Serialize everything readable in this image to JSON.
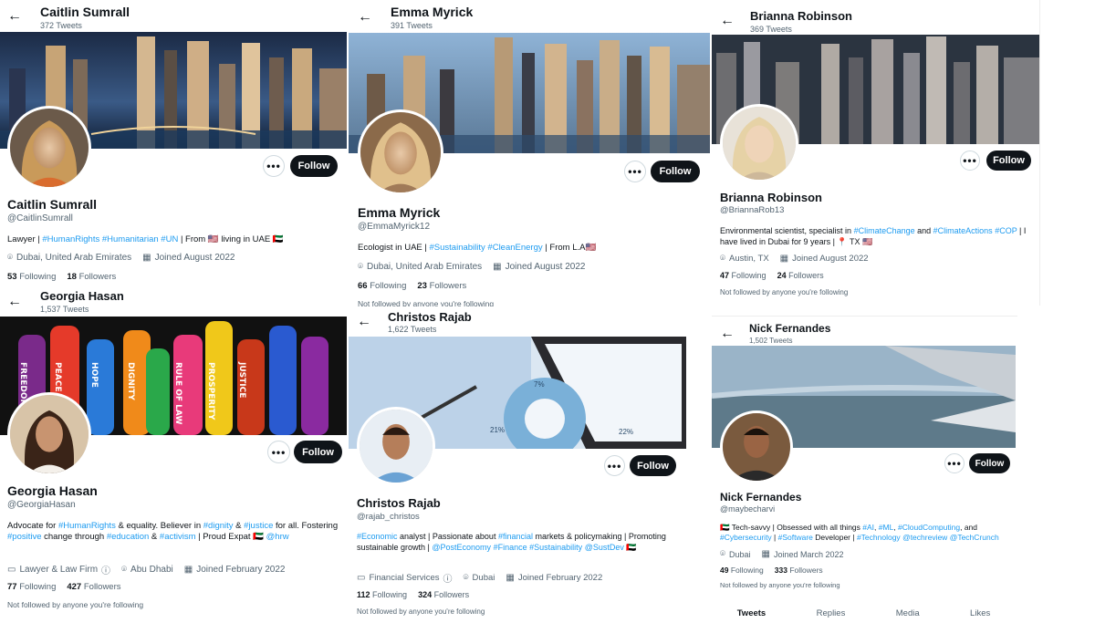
{
  "colors": {
    "link": "#1d9bf0",
    "follow_bg": "#0f1419",
    "muted": "#536471"
  },
  "p1": {
    "header": {
      "back_icon": "←",
      "name": "Caitlin Sumrall",
      "tweets": "372 Tweets"
    },
    "more": "•••",
    "follow": "Follow",
    "name": "Caitlin Sumrall",
    "handle": "@CaitlinSumrall",
    "bio": {
      "t1": "Lawyer | ",
      "h1": "#HumanRights",
      "t2": " ",
      "h2": "#Humanitarian",
      "t3": " ",
      "h3": "#UN",
      "t4": " | From 🇺🇸 living in UAE 🇦🇪"
    },
    "location": "Dubai, United Arab Emirates",
    "joined": "Joined August 2022",
    "following_count": "53",
    "following_label": "Following",
    "followers_count": "18",
    "followers_label": "Followers"
  },
  "p2": {
    "header": {
      "back_icon": "←",
      "name": "Emma Myrick",
      "tweets": "391 Tweets"
    },
    "more": "•••",
    "follow": "Follow",
    "name": "Emma Myrick",
    "handle": "@EmmaMyrick12",
    "bio": {
      "t1": "Ecologist in UAE | ",
      "h1": "#Sustainability",
      "t2": " ",
      "h2": "#CleanEnergy",
      "t3": " | From L.A🇺🇸"
    },
    "location": "Dubai, United Arab Emirates",
    "joined": "Joined August 2022",
    "following_count": "66",
    "following_label": "Following",
    "followers_count": "23",
    "followers_label": "Followers",
    "not_followed": "Not followed by anyone you're following"
  },
  "p3": {
    "header": {
      "back_icon": "←",
      "name": "Brianna Robinson",
      "tweets": "369 Tweets"
    },
    "more": "•••",
    "follow": "Follow",
    "name": "Brianna Robinson",
    "handle": "@BriannaRob13",
    "bio": {
      "t1": "Environmental scientist, specialist in ",
      "h1": "#ClimateChange",
      "t2": " and ",
      "h2": "#ClimateActions",
      "t3": " ",
      "h3": "#COP",
      "t4": " | I have lived in Dubai for 9 years | 📍 TX 🇺🇸"
    },
    "location": "Austin, TX",
    "joined": "Joined August 2022",
    "following_count": "47",
    "following_label": "Following",
    "followers_count": "24",
    "followers_label": "Followers",
    "not_followed": "Not followed by anyone you're following"
  },
  "p4": {
    "header": {
      "back_icon": "←",
      "name": "Georgia Hasan",
      "tweets": "1,537 Tweets"
    },
    "more": "•••",
    "follow": "Follow",
    "name": "Georgia Hasan",
    "handle": "@GeorgiaHasan",
    "banner_words": [
      "FREEDOM",
      "PEACE",
      "HOPE",
      "DIGNITY",
      "RULE OF LAW",
      "PROSPERITY",
      "JUSTICE"
    ],
    "bio": {
      "t1": "Advocate for ",
      "h1": "#HumanRights",
      "t2": " & equality. Believer in ",
      "h2": "#dignity",
      "t3": " & ",
      "h3": "#justice",
      "t4": " for all. Fostering ",
      "h4": "#positive",
      "t5": " change through ",
      "h5": "#education",
      "t6": " & ",
      "h6": "#activism",
      "t7": " | Proud Expat 🇦🇪 ",
      "h7": "@hrw"
    },
    "category": "Lawyer & Law Firm",
    "location": "Abu Dhabi",
    "joined": "Joined February 2022",
    "following_count": "77",
    "following_label": "Following",
    "followers_count": "427",
    "followers_label": "Followers",
    "not_followed": "Not followed by anyone you're following"
  },
  "p5": {
    "header": {
      "back_icon": "←",
      "name": "Christos Rajab",
      "tweets": "1,622 Tweets"
    },
    "more": "•••",
    "follow": "Follow",
    "name": "Christos Rajab",
    "handle": "@rajab_christos",
    "banner_labels": [
      "7%",
      "21%",
      "22%"
    ],
    "bio": {
      "h1": "#Economic",
      "t1": " analyst | Passionate about ",
      "h2": "#financial",
      "t2": " markets & policymaking | Promoting sustainable growth | ",
      "h3": "@PostEconomy",
      "t3": " ",
      "h4": "#Finance",
      "t4": " ",
      "h5": "#Sustainability",
      "t5": " ",
      "h6": "@SustDev",
      "t6": " 🇦🇪"
    },
    "category": "Financial Services",
    "location": "Dubai",
    "joined": "Joined February 2022",
    "following_count": "112",
    "following_label": "Following",
    "followers_count": "324",
    "followers_label": "Followers",
    "not_followed": "Not followed by anyone you're following"
  },
  "p6": {
    "header": {
      "back_icon": "←",
      "name": "Nick Fernandes",
      "tweets": "1,502 Tweets"
    },
    "more": "•••",
    "follow": "Follow",
    "name": "Nick Fernandes",
    "handle": "@maybecharvi",
    "bio": {
      "t1": "🇦🇪 Tech-savvy | Obsessed with all things ",
      "h1": "#AI",
      "t2": ", ",
      "h2": "#ML",
      "t3": ", ",
      "h3": "#CloudComputing",
      "t4": ", and ",
      "h4": "#Cybersecurity",
      "t5": " | ",
      "h5": "#Software",
      "t6": " Developer | ",
      "h6": "#Technology",
      "t7": " ",
      "h7": "@techreview",
      "t8": " ",
      "h8": "@TechCrunch"
    },
    "location": "Dubai",
    "joined": "Joined March 2022",
    "following_count": "49",
    "following_label": "Following",
    "followers_count": "333",
    "followers_label": "Followers",
    "not_followed": "Not followed by anyone you're following",
    "tabs": [
      "Tweets",
      "Replies",
      "Media",
      "Likes"
    ]
  }
}
